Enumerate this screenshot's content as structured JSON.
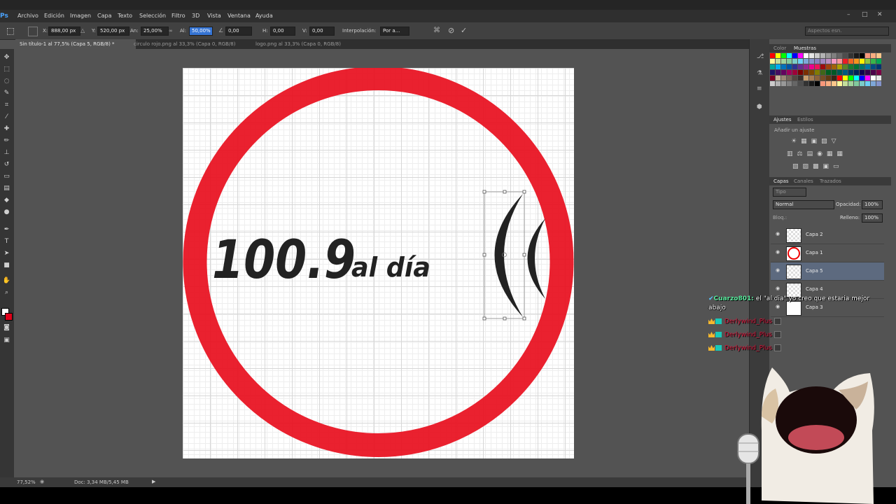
{
  "app": {
    "logo": "Ps",
    "menu": [
      "Archivo",
      "Edición",
      "Imagen",
      "Capa",
      "Texto",
      "Selección",
      "Filtro",
      "3D",
      "Vista",
      "Ventana",
      "Ayuda"
    ],
    "workspace": "Aspectos esn."
  },
  "options": {
    "x_label": "X:",
    "x_value": "888,00 px",
    "y_label": "Y:",
    "y_value": "520,00 px",
    "w_label": "An:",
    "w_value": "25,00%",
    "h_label": "Al:",
    "h_value": "50,00%",
    "angle_value": "0,00",
    "hskew_label": "H:",
    "hskew_value": "0,00",
    "vskew_label": "V:",
    "vskew_value": "0,00",
    "interp_label": "Interpolación:",
    "interp_value": "Por a..."
  },
  "tabs": [
    {
      "label": "Sin título-1 al 77,5% (Capa 5, RGB/8) *",
      "active": true
    },
    {
      "label": "circulo rojo.png al 33,3% (Capa 0, RGB/8)",
      "active": false
    },
    {
      "label": "logo.png al 33,3% (Capa 0, RGB/8)",
      "active": false
    }
  ],
  "canvas": {
    "logo_number": "100.9",
    "logo_text": "al día",
    "ring_color": "#e8101f",
    "text_color": "#222222"
  },
  "status": {
    "zoom": "77,52%",
    "doc": "Doc: 3,34 MB/5,45 MB"
  },
  "panels": {
    "color_tab": "Color",
    "swatches_tab": "Muestras",
    "adjust_tab": "Ajustes",
    "styles_tab": "Estilos",
    "adjust_hint": "Añadir un ajuste",
    "layers_tab": "Capas",
    "channels_tab": "Canales",
    "paths_tab": "Trazados",
    "kind_filter": "Tipo",
    "blend_mode": "Normal",
    "opacity_label": "Opacidad:",
    "opacity_value": "100%",
    "lock_label": "Bloq.:",
    "fill_label": "Relleno:",
    "fill_value": "100%"
  },
  "layers": [
    {
      "name": "Capa 2",
      "selected": false
    },
    {
      "name": "Capa 1",
      "selected": false
    },
    {
      "name": "Capa 5",
      "selected": true
    },
    {
      "name": "Capa 4",
      "selected": false
    },
    {
      "name": "Capa 3",
      "selected": false
    }
  ],
  "chat": [
    {
      "user": "Cuarzo801:",
      "message": "el \"al dia\" yo creo que estaria mejor abajo"
    },
    {
      "user": "Derlywind_Plus",
      "message": ""
    },
    {
      "user": "Derlywind_Plus",
      "message": ""
    },
    {
      "user": "Derlywind_Plus",
      "message": ""
    }
  ]
}
